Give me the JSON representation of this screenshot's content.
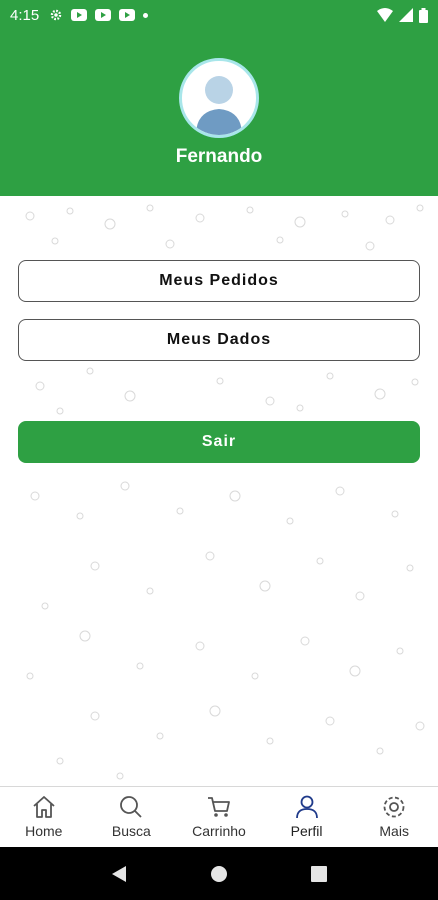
{
  "status_bar": {
    "time": "4:15"
  },
  "profile": {
    "name": "Fernando"
  },
  "buttons": {
    "orders": "Meus Pedidos",
    "data": "Meus Dados",
    "logout": "Sair"
  },
  "bottom_nav": {
    "items": [
      {
        "label": "Home",
        "icon": "home-icon"
      },
      {
        "label": "Busca",
        "icon": "search-icon"
      },
      {
        "label": "Carrinho",
        "icon": "cart-icon"
      },
      {
        "label": "Perfil",
        "icon": "person-icon"
      },
      {
        "label": "Mais",
        "icon": "gear-icon"
      }
    ]
  },
  "colors": {
    "primary": "#2ea043",
    "avatar_ring": "#a8e6ea"
  }
}
